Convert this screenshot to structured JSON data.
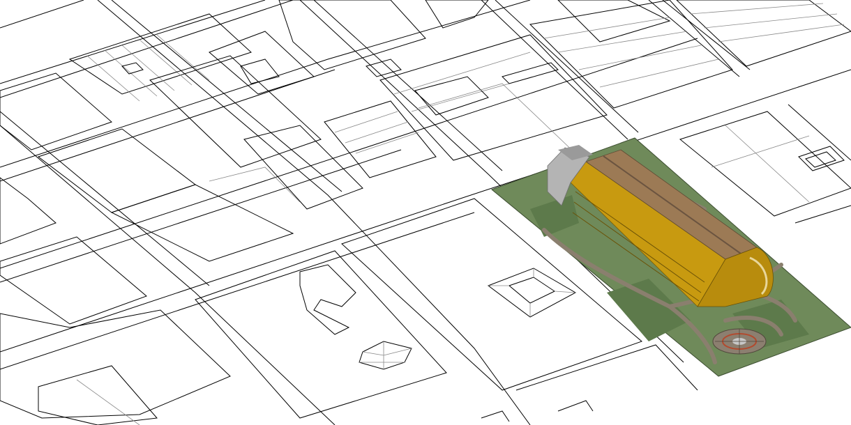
{
  "colors": {
    "background": "#ffffff",
    "linework": "#000000",
    "lawn": "#6f8a5a",
    "lawn_dark": "#5d7a4b",
    "paving": "#8c7f70",
    "roof": "#9c7a55",
    "facade": "#c89a10",
    "facade_shadow": "#a9810c",
    "annex": "#b4b4b4",
    "annex_dark": "#9a9a9a"
  },
  "icons": {
    "compass_rose_left": "octagon-star-icon",
    "compass_rose_right": "octagon-star-icon"
  }
}
